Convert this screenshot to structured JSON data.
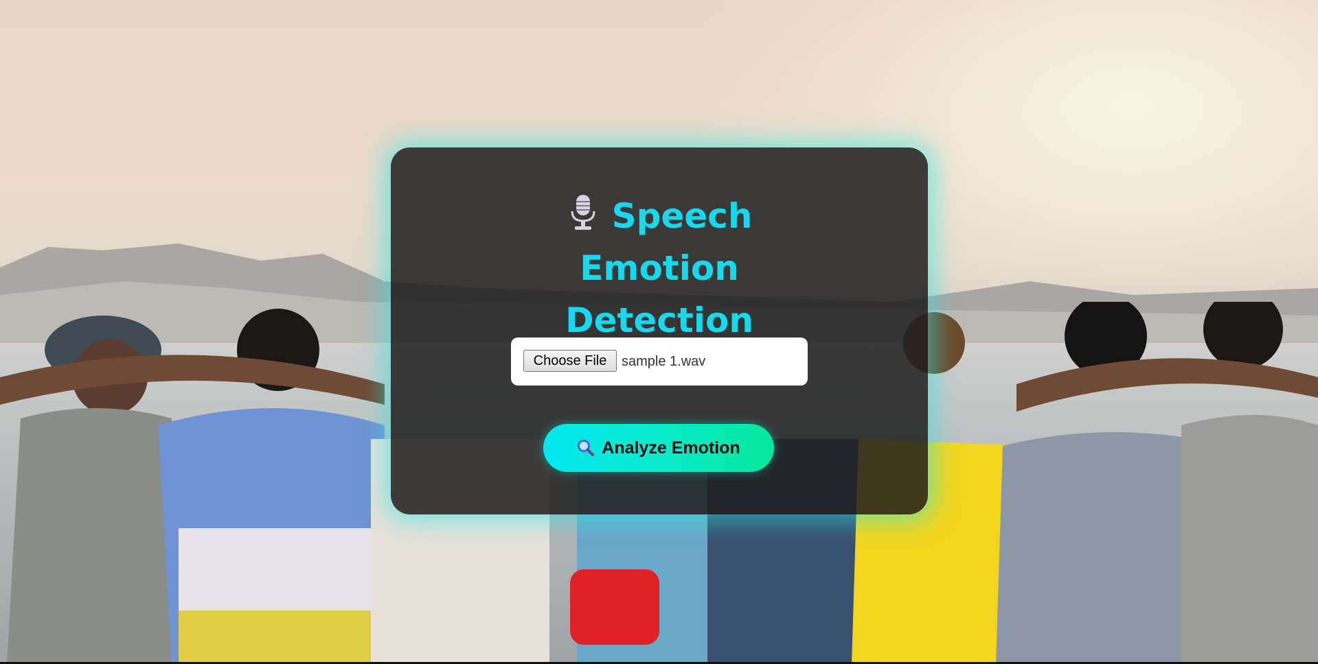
{
  "app": {
    "title_line1": "Speech Emotion",
    "title_line2": "Detection",
    "title_icon": "microphone-icon",
    "accent_color": "#14d9ef"
  },
  "upload": {
    "button_label": "Choose File",
    "file_name": "sample 1.wav"
  },
  "actions": {
    "analyze_label": "Analyze Emotion",
    "analyze_icon": "magnifier-icon",
    "button_gradient": [
      "#05e6f0",
      "#05e79a"
    ]
  },
  "background": {
    "description_icon": "photo-background"
  }
}
